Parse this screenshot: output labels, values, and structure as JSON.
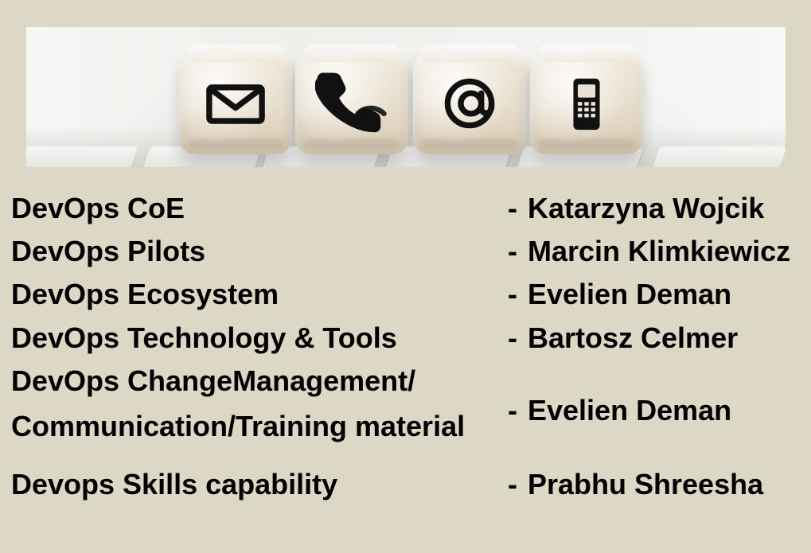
{
  "banner": {
    "icons": [
      "envelope-icon",
      "phone-icon",
      "at-sign-icon",
      "mobile-phone-icon"
    ]
  },
  "rows": [
    {
      "topic": "DevOps CoE",
      "dash": "-",
      "person": "Katarzyna Wojcik"
    },
    {
      "topic": "DevOps Pilots",
      "dash": "-",
      "person": "Marcin Klimkiewicz"
    },
    {
      "topic": "DevOps Ecosystem",
      "dash": "-",
      "person": "Evelien Deman"
    },
    {
      "topic": "DevOps Technology & Tools",
      "dash": "-",
      "person": "Bartosz Celmer"
    },
    {
      "topic_line1": "DevOps ChangeManagement/",
      "topic_line2": "Communication/Training material",
      "dash": "-",
      "person": "Evelien Deman"
    },
    {
      "topic": "Devops Skills capability",
      "dash": "-",
      "person": "Prabhu Shreesha"
    }
  ],
  "colors": {
    "background": "#ddd8c5",
    "text": "#000000"
  }
}
